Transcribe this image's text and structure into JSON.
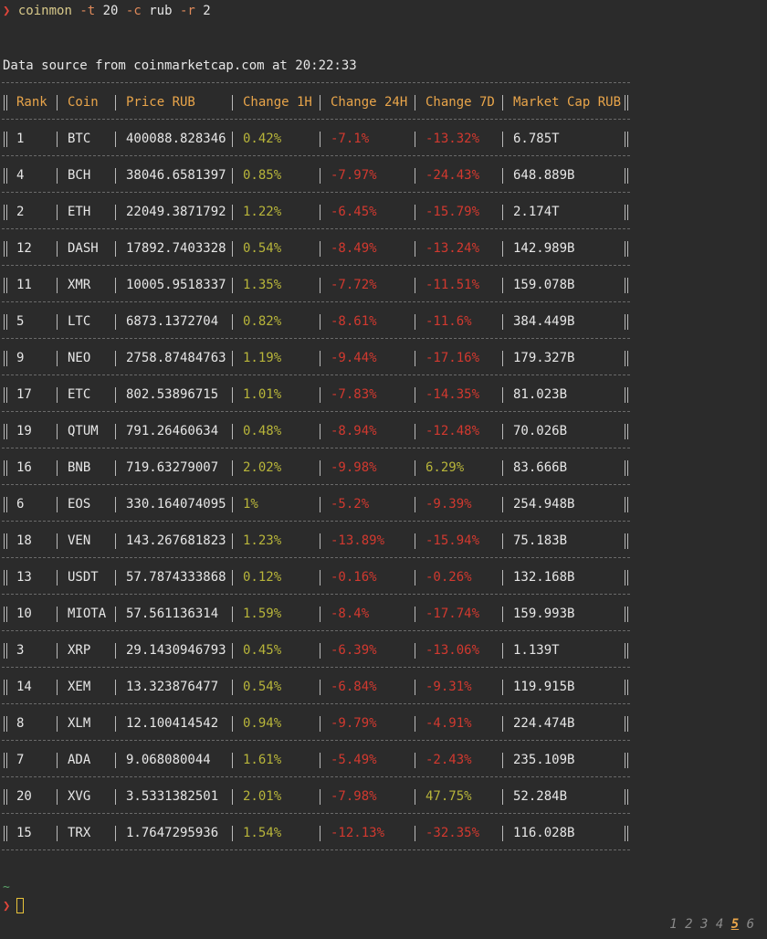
{
  "terminal": {
    "prompt_symbol": "❯",
    "command": {
      "program": "coinmon",
      "flag_top": "-t",
      "top_value": "20",
      "flag_currency": "-c",
      "currency_value": "rub",
      "flag_rows": "-r",
      "rows_value": "2"
    },
    "source_line": "Data source from coinmarketcap.com at 20:22:33",
    "tilde": "~"
  },
  "table": {
    "headers": [
      "Rank",
      "Coin",
      "Price RUB",
      "Change 1H",
      "Change 24H",
      "Change 7D",
      "Market Cap RUB"
    ],
    "rows": [
      {
        "rank": "1",
        "coin": "BTC",
        "price": "400088.828346",
        "ch1h": "0.42%",
        "ch24h": "-7.1%",
        "ch7d": "-13.32%",
        "mcap": "6.785T"
      },
      {
        "rank": "4",
        "coin": "BCH",
        "price": "38046.6581397",
        "ch1h": "0.85%",
        "ch24h": "-7.97%",
        "ch7d": "-24.43%",
        "mcap": "648.889B"
      },
      {
        "rank": "2",
        "coin": "ETH",
        "price": "22049.3871792",
        "ch1h": "1.22%",
        "ch24h": "-6.45%",
        "ch7d": "-15.79%",
        "mcap": "2.174T"
      },
      {
        "rank": "12",
        "coin": "DASH",
        "price": "17892.7403328",
        "ch1h": "0.54%",
        "ch24h": "-8.49%",
        "ch7d": "-13.24%",
        "mcap": "142.989B"
      },
      {
        "rank": "11",
        "coin": "XMR",
        "price": "10005.9518337",
        "ch1h": "1.35%",
        "ch24h": "-7.72%",
        "ch7d": "-11.51%",
        "mcap": "159.078B"
      },
      {
        "rank": "5",
        "coin": "LTC",
        "price": "6873.1372704",
        "ch1h": "0.82%",
        "ch24h": "-8.61%",
        "ch7d": "-11.6%",
        "mcap": "384.449B"
      },
      {
        "rank": "9",
        "coin": "NEO",
        "price": "2758.87484763",
        "ch1h": "1.19%",
        "ch24h": "-9.44%",
        "ch7d": "-17.16%",
        "mcap": "179.327B"
      },
      {
        "rank": "17",
        "coin": "ETC",
        "price": "802.53896715",
        "ch1h": "1.01%",
        "ch24h": "-7.83%",
        "ch7d": "-14.35%",
        "mcap": "81.023B"
      },
      {
        "rank": "19",
        "coin": "QTUM",
        "price": "791.26460634",
        "ch1h": "0.48%",
        "ch24h": "-8.94%",
        "ch7d": "-12.48%",
        "mcap": "70.026B"
      },
      {
        "rank": "16",
        "coin": "BNB",
        "price": "719.63279007",
        "ch1h": "2.02%",
        "ch24h": "-9.98%",
        "ch7d": "6.29%",
        "mcap": "83.666B"
      },
      {
        "rank": "6",
        "coin": "EOS",
        "price": "330.164074095",
        "ch1h": "1%",
        "ch24h": "-5.2%",
        "ch7d": "-9.39%",
        "mcap": "254.948B"
      },
      {
        "rank": "18",
        "coin": "VEN",
        "price": "143.267681823",
        "ch1h": "1.23%",
        "ch24h": "-13.89%",
        "ch7d": "-15.94%",
        "mcap": "75.183B"
      },
      {
        "rank": "13",
        "coin": "USDT",
        "price": "57.7874333868",
        "ch1h": "0.12%",
        "ch24h": "-0.16%",
        "ch7d": "-0.26%",
        "mcap": "132.168B"
      },
      {
        "rank": "10",
        "coin": "MIOTA",
        "price": "57.561136314",
        "ch1h": "1.59%",
        "ch24h": "-8.4%",
        "ch7d": "-17.74%",
        "mcap": "159.993B"
      },
      {
        "rank": "3",
        "coin": "XRP",
        "price": "29.1430946793",
        "ch1h": "0.45%",
        "ch24h": "-6.39%",
        "ch7d": "-13.06%",
        "mcap": "1.139T"
      },
      {
        "rank": "14",
        "coin": "XEM",
        "price": "13.323876477",
        "ch1h": "0.54%",
        "ch24h": "-6.84%",
        "ch7d": "-9.31%",
        "mcap": "119.915B"
      },
      {
        "rank": "8",
        "coin": "XLM",
        "price": "12.100414542",
        "ch1h": "0.94%",
        "ch24h": "-9.79%",
        "ch7d": "-4.91%",
        "mcap": "224.474B"
      },
      {
        "rank": "7",
        "coin": "ADA",
        "price": "9.068080044",
        "ch1h": "1.61%",
        "ch24h": "-5.49%",
        "ch7d": "-2.43%",
        "mcap": "235.109B"
      },
      {
        "rank": "20",
        "coin": "XVG",
        "price": "3.5331382501",
        "ch1h": "2.01%",
        "ch24h": "-7.98%",
        "ch7d": "47.75%",
        "mcap": "52.284B"
      },
      {
        "rank": "15",
        "coin": "TRX",
        "price": "1.7647295936",
        "ch1h": "1.54%",
        "ch24h": "-12.13%",
        "ch7d": "-32.35%",
        "mcap": "116.028B"
      }
    ]
  },
  "workspaces": {
    "items": [
      "1",
      "2",
      "3",
      "4",
      "5",
      "6"
    ],
    "active": "5"
  },
  "colors": {
    "background": "#2b2b2b",
    "header": "#e9a54a",
    "positive": "#b8b53a",
    "negative": "#d2392f",
    "prompt": "#e0453a"
  }
}
